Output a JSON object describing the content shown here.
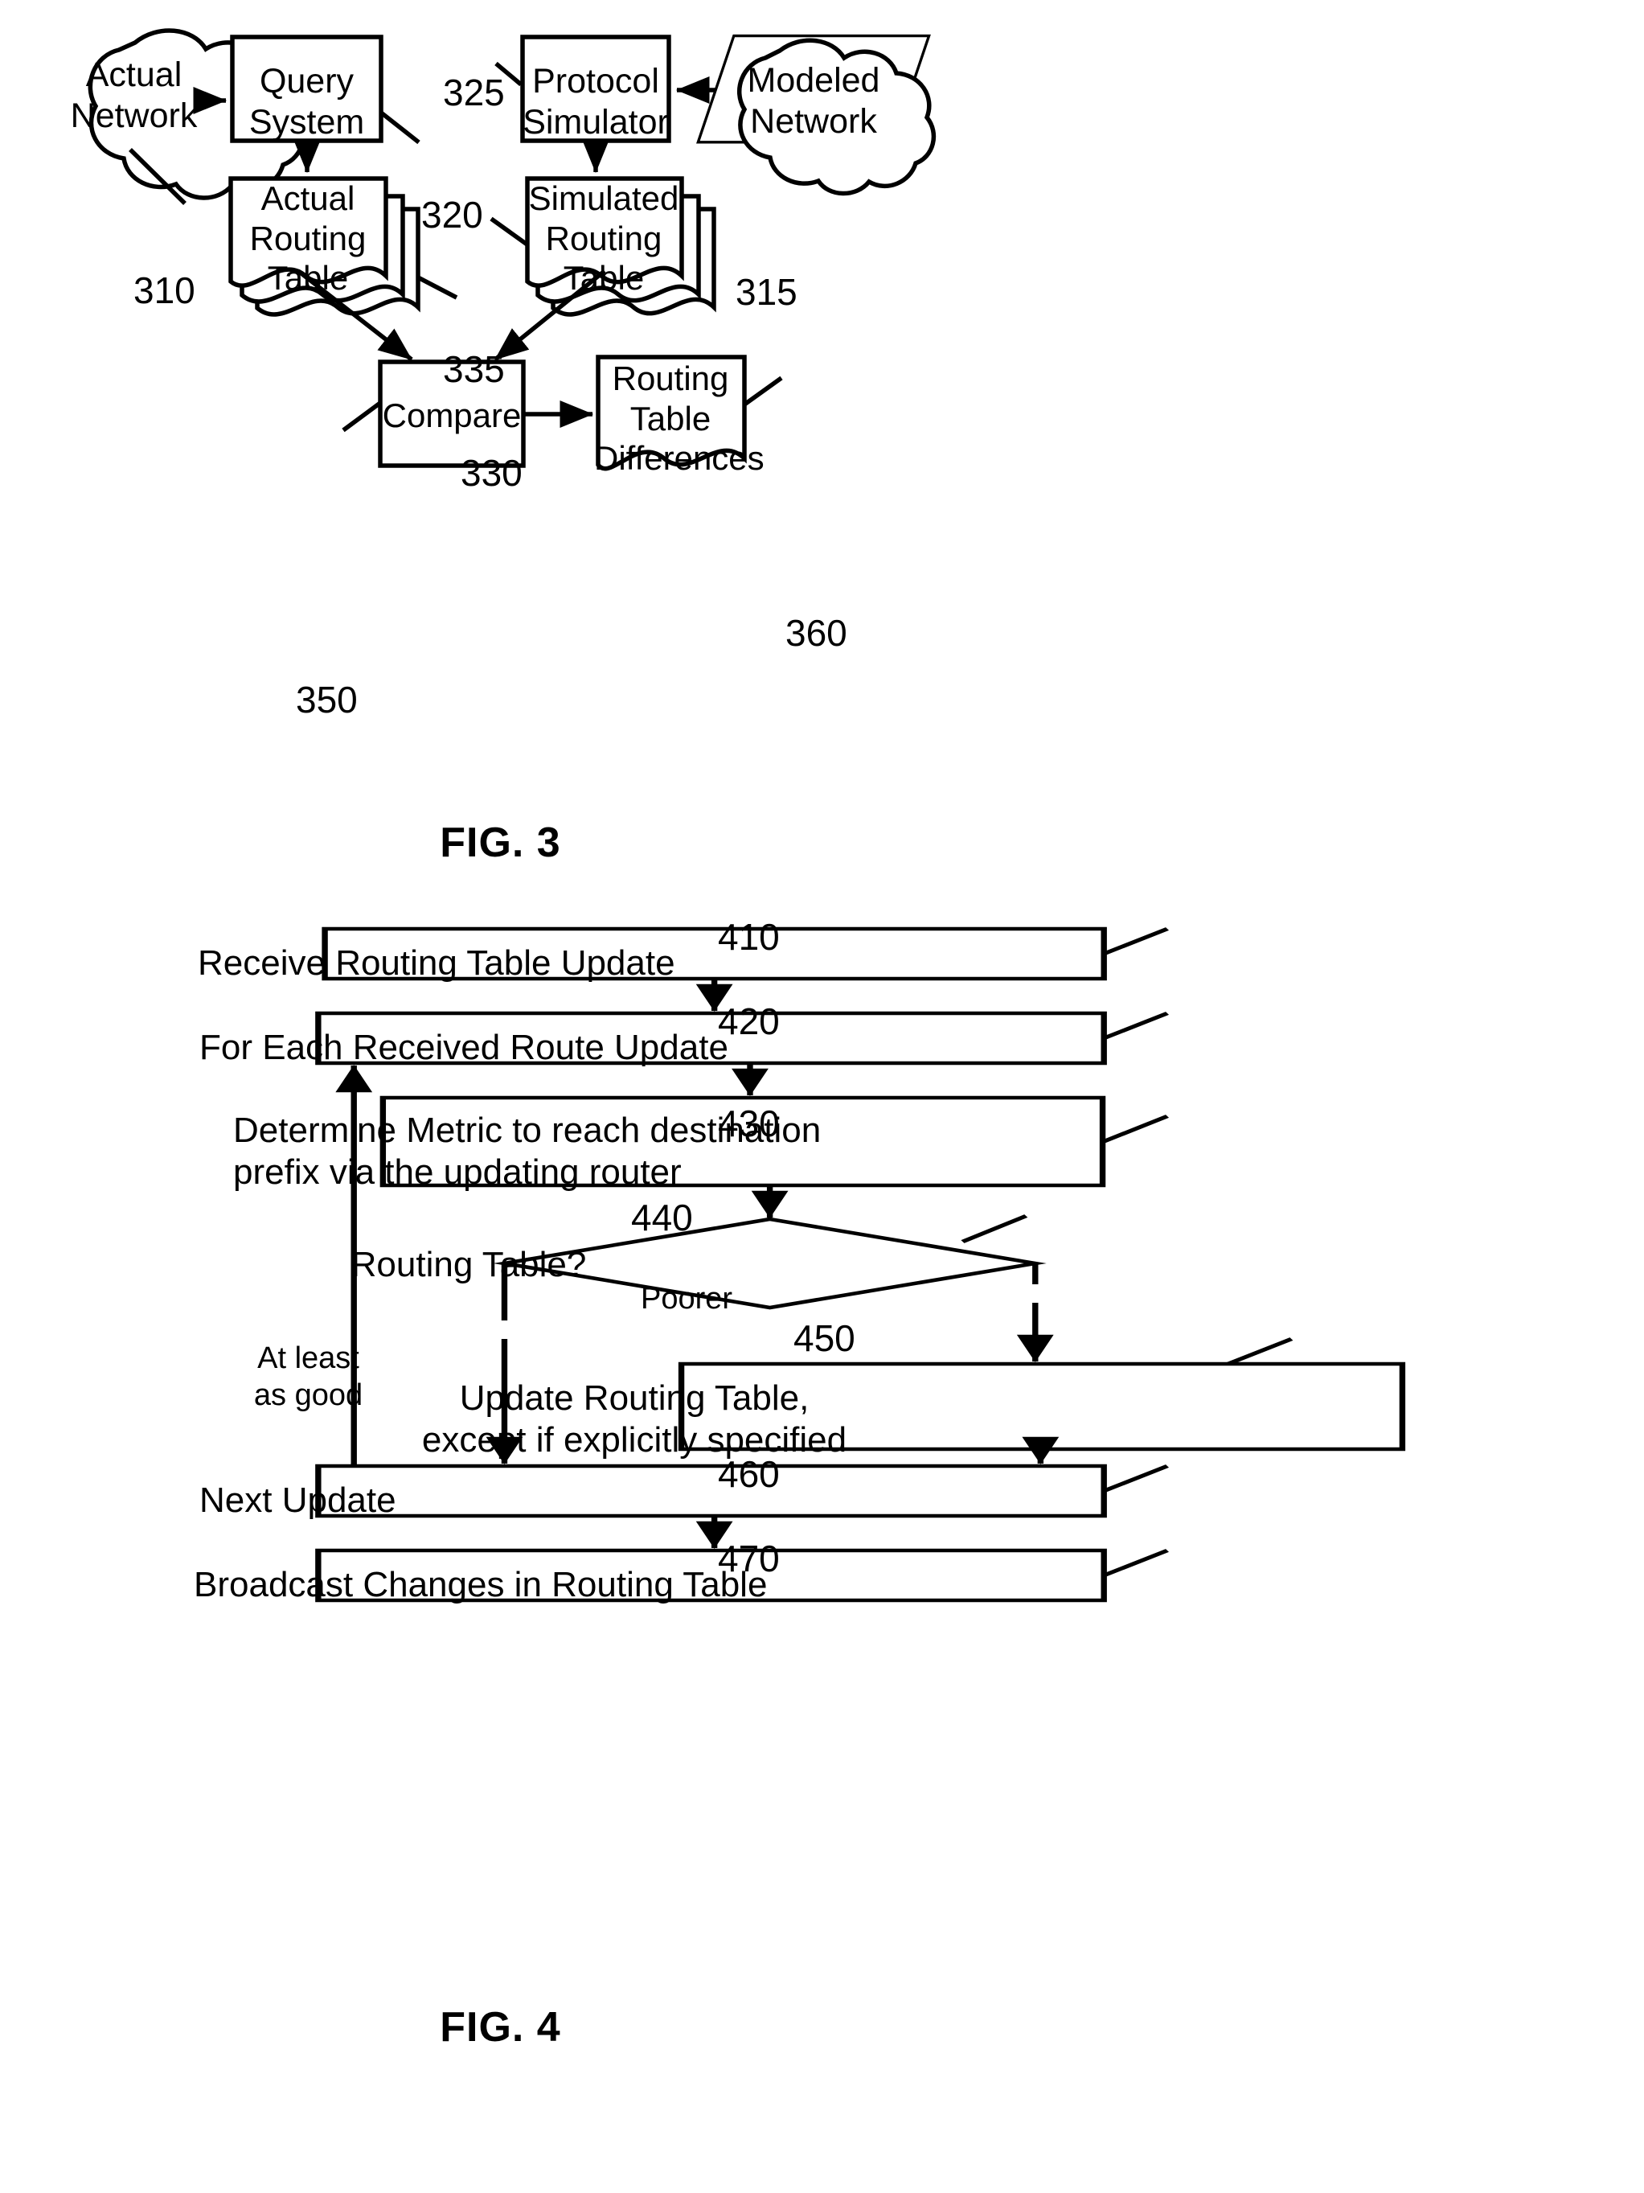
{
  "figures": [
    {
      "id": "fig3",
      "caption": "FIG. 3",
      "nodes": {
        "actual_network": "Actual\nNetwork",
        "query_system": "Query\nSystem",
        "protocol_simulator": "Protocol\nSimulator",
        "modeled_network": "Modeled\nNetwork",
        "actual_routing_table": "Actual\nRouting\nTable",
        "simulated_routing_table": "Simulated\nRouting\nTable",
        "compare": "Compare",
        "routing_table_differences": "Routing\nTable\nDifferences"
      },
      "refs": {
        "actual_network": "310",
        "modeled_network": "315",
        "query_system": "320",
        "protocol_simulator": "325",
        "actual_routing_table": "330",
        "simulated_routing_table": "335",
        "compare": "350",
        "routing_table_differences": "360"
      }
    },
    {
      "id": "fig4",
      "caption": "FIG. 4",
      "nodes": {
        "receive_update": "Receive Routing Table Update",
        "for_each_update": "For Each Received Route Update",
        "determine_metric": "Determine Metric to reach destination\nprefix via the updating router",
        "decision": "Routing Table?",
        "update_routing_table": "Update Routing Table,\nexcept if explicitly specified",
        "next_update": "Next Update",
        "broadcast_changes": "Broadcast Changes in Routing Table"
      },
      "refs": {
        "receive_update": "410",
        "for_each_update": "420",
        "determine_metric": "430",
        "decision": "440",
        "update_routing_table": "450",
        "next_update": "460",
        "broadcast_changes": "470"
      },
      "branch_labels": {
        "left": "At least\nas good",
        "right": "Poorer"
      }
    }
  ],
  "style": {
    "ink": "#000000",
    "paper": "#ffffff"
  }
}
